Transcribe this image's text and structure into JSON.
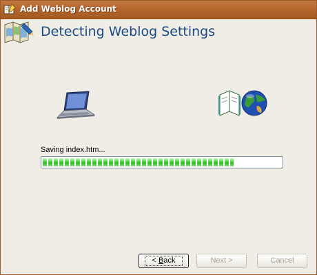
{
  "window": {
    "title": "Add Weblog Account",
    "header_title": "Detecting Weblog Settings"
  },
  "icons": {
    "title_icon": "weblog-writer-icon",
    "header_icon": "book-map-icon",
    "left_illustration": "laptop-icon",
    "right_illustration": "book-globe-icon"
  },
  "status": {
    "text": "Saving index.htm...",
    "progress_fraction": 0.8
  },
  "buttons": {
    "back": {
      "prefix": "< ",
      "mnemonic": "B",
      "rest": "ack",
      "enabled": true
    },
    "next": {
      "label": "Next >",
      "enabled": false
    },
    "cancel": {
      "label": "Cancel",
      "enabled": false
    }
  },
  "colors": {
    "titlebar": "#b5672d",
    "header_text": "#1b4a84",
    "progress_green": "#2fbc25",
    "dialog_bg": "#efede6"
  }
}
